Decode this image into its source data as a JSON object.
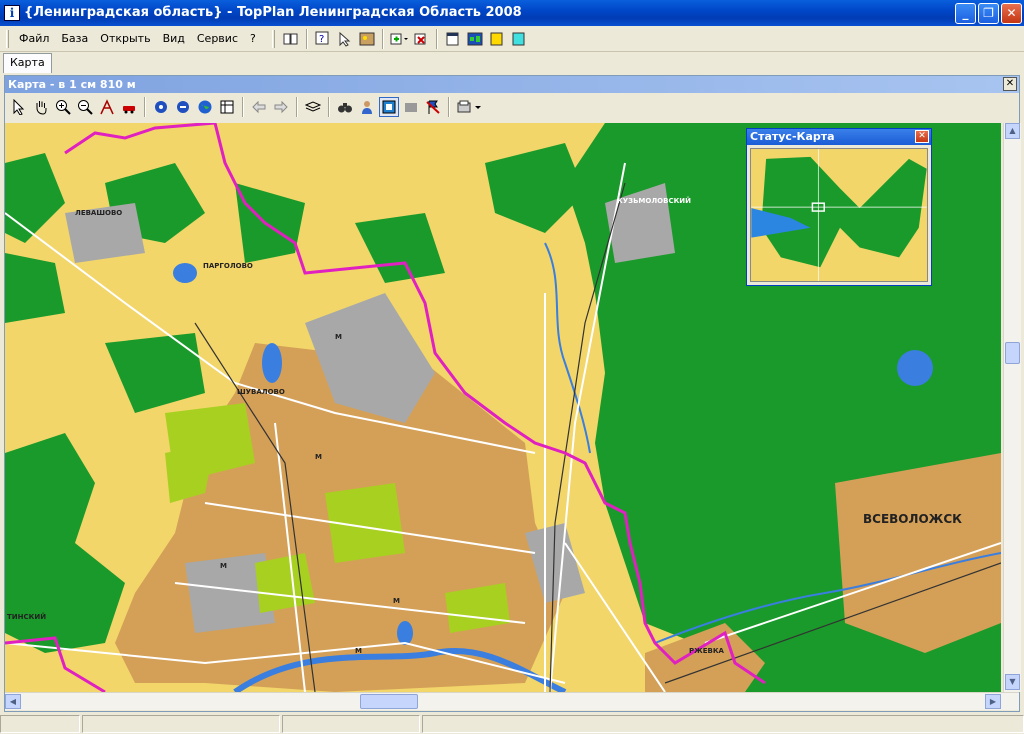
{
  "window": {
    "icon_glyph": "i",
    "title": "{Ленинградская область} - TopPlan Ленинградская Область 2008",
    "buttons": {
      "minimize": "_",
      "maximize": "❐",
      "close": "✕"
    }
  },
  "menu": {
    "items": [
      "Файл",
      "База",
      "Открыть",
      "Вид",
      "Сервис",
      "?"
    ]
  },
  "main_toolbar": {
    "icons": [
      "book-icon",
      "help-pointer-icon",
      "pointer-info-icon",
      "image-icon",
      "add-layer-dropdown-icon",
      "remove-layer-icon",
      "window-icon",
      "world-map-icon",
      "yellow-doc-icon",
      "cyan-doc-icon"
    ]
  },
  "tabs": [
    {
      "label": "Карта",
      "active": true
    }
  ],
  "map_window": {
    "title": "Карта - в 1 см 810 м",
    "close_glyph": "✕",
    "toolbar_icons": [
      "select-arrow-icon",
      "pan-hand-icon",
      "zoom-in-icon",
      "zoom-out-icon",
      "measure-icon",
      "car-route-icon",
      "center-icon",
      "minus-circle-icon",
      "globe-icon",
      "grid-icon",
      "back-arrow-icon",
      "forward-arrow-icon",
      "layers-icon",
      "binoculars-icon",
      "person-search-icon",
      "overview-toggle-icon",
      "gray-box-icon",
      "flag-off-icon",
      "print-dropdown-icon"
    ]
  },
  "status_map": {
    "title": "Статус-Карта",
    "close_glyph": "✕"
  },
  "map_labels": {
    "levashovo": "ЛЕВАШОВО",
    "pargolovo": "ПАРГОЛОВО",
    "shuvalovo": "ШУВАЛОВО",
    "vsevolozhsk": "ВСЕВОЛОЖСК",
    "kuzmolovsky": "КУЗЬМОЛОВСКИЙ",
    "rzhevka": "РЖЕВКА",
    "tinsky": "ТИНСКИЙ",
    "metro": "М"
  },
  "colors": {
    "forest": "#1a9a2a",
    "field": "#f2d66a",
    "urban": "#d4a058",
    "industrial": "#a8a8a8",
    "water": "#3a7ee0",
    "boundary": "#e020c0",
    "park": "#a8d020"
  }
}
